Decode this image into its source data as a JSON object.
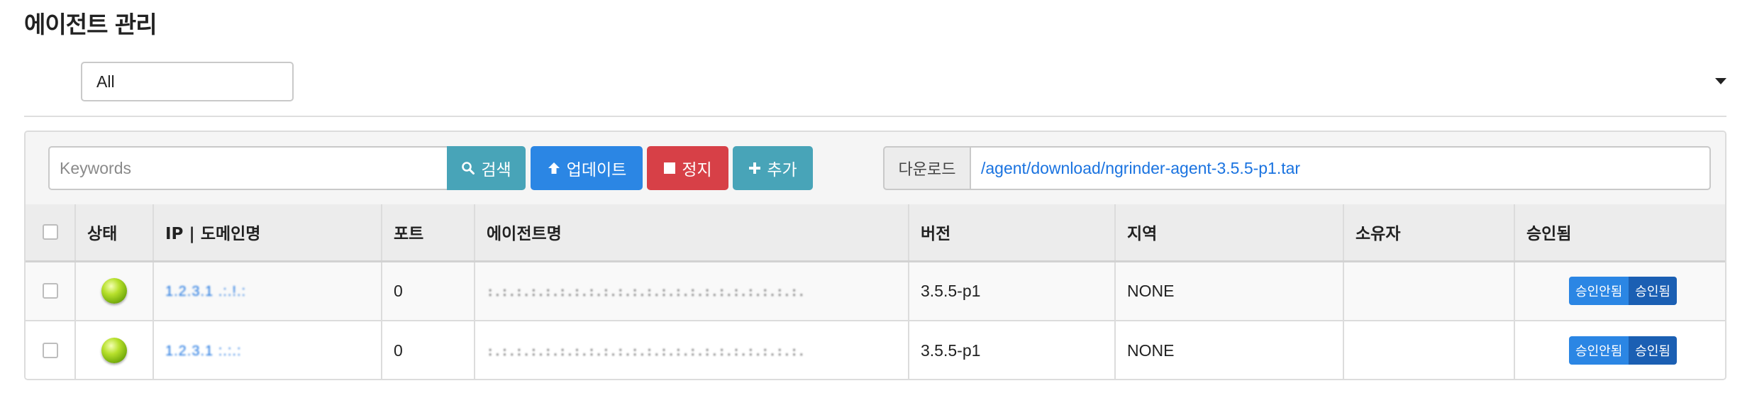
{
  "page": {
    "title": "에이전트 관리"
  },
  "region_filter": {
    "selected": "All"
  },
  "toolbar": {
    "search_placeholder": "Keywords",
    "search_label": "검색",
    "update_label": "업데이트",
    "stop_label": "정지",
    "add_label": "추가",
    "download_label": "다운로드",
    "download_path": "/agent/download/ngrinder-agent-3.5.5-p1.tar"
  },
  "colors": {
    "accent": "#2b86e4",
    "info": "#48a4b8",
    "danger": "#d74047",
    "link": "#1a73e0",
    "status_ok": "#9acd32"
  },
  "table": {
    "headers": {
      "status": "상태",
      "ip": "IP | 도메인명",
      "port": "포트",
      "name": "에이전트명",
      "version": "버전",
      "region": "지역",
      "owner": "소유자",
      "approved": "승인됨"
    },
    "approve_off_label": "승인안됨",
    "approve_on_label": "승인됨",
    "rows": [
      {
        "status_icon": "green-ball-icon",
        "ip": "1.2.3.1 .:.!.:",
        "port": "0",
        "name": ":.:.:.:.:.:.:.:.:.:.:.:.:.:.:.:.:.:.:.:.:.:.",
        "version": "3.5.5-p1",
        "region": "NONE",
        "owner": ""
      },
      {
        "status_icon": "green-ball-icon",
        "ip": "1.2.3.1 :.:.:",
        "port": "0",
        "name": ":.:.:.:.:.:.:.:.:.:.:.:.:.:.:.:.:.:.:.:.:.:.",
        "version": "3.5.5-p1",
        "region": "NONE",
        "owner": ""
      }
    ]
  }
}
